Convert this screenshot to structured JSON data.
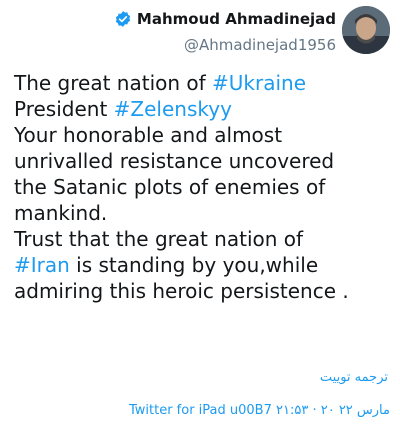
{
  "author": {
    "display_name": "Mahmoud Ahmadinejad",
    "handle": "@Ahmadinejad1956",
    "verified_icon": "verified-badge-icon",
    "avatar_icon": "avatar-photo"
  },
  "tweet": {
    "lines": [
      {
        "plain": "The great nation of ",
        "tag": "#Ukraine"
      },
      {
        "plain": "President ",
        "tag": "#Zelenskyy"
      },
      {
        "plain": "Your honorable and almost",
        "tag": ""
      },
      {
        "plain": "unrivalled resistance uncovered",
        "tag": ""
      },
      {
        "plain": "the Satanic plots of enemies of",
        "tag": ""
      },
      {
        "plain": "mankind.",
        "tag": ""
      },
      {
        "plain": "Trust that the great nation of",
        "tag": ""
      },
      {
        "tag": "#Iran",
        "rest": " is standing by you,while"
      },
      {
        "plain": "admiring this heroic persistence .",
        "tag": ""
      }
    ]
  },
  "translate_label": "ترجمه توییت",
  "meta_text": "Twitter for iPad u00B7 ۲۱:۵۳ · ۲۰ مارس ۲۲",
  "colors": {
    "accent": "#1d9bf0",
    "text": "#14171a",
    "muted": "#657786"
  }
}
